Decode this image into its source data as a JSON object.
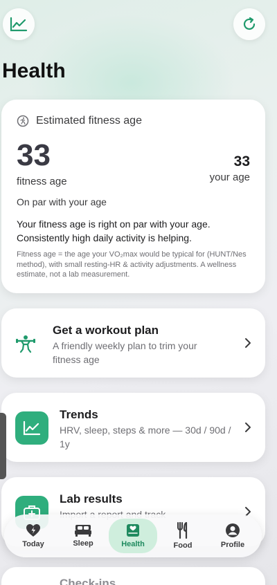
{
  "header": {
    "title": "Health"
  },
  "fitness": {
    "header_label": "Estimated fitness age",
    "fitness_age": "33",
    "fitness_age_label": "fitness age",
    "your_age": "33",
    "your_age_label": "your age",
    "status": "On par with your age",
    "message": "Your fitness age is right on par with your age. Consistently high daily activity is helping.",
    "note": "Fitness age = the age your VO₂max would be typical for (HUNT/Nes method), with small resting-HR & activity adjustments. A wellness estimate, not a lab measurement."
  },
  "workout": {
    "title": "Get a workout plan",
    "subtitle": "A friendly weekly plan to trim your fitness age"
  },
  "trends": {
    "title": "Trends",
    "subtitle": "HRV, sleep, steps & more — 30d / 90d / 1y"
  },
  "lab": {
    "title": "Lab results",
    "subtitle": "Import a report and track"
  },
  "checkins": {
    "title": "Check-ins"
  },
  "tabs": [
    {
      "label": "Today",
      "icon": "heart-bolt-icon"
    },
    {
      "label": "Sleep",
      "icon": "bed-icon"
    },
    {
      "label": "Health",
      "icon": "health-icon",
      "active": true
    },
    {
      "label": "Food",
      "icon": "fork-knife-icon"
    },
    {
      "label": "Profile",
      "icon": "person-icon"
    }
  ],
  "colors": {
    "accent": "#2fae7d",
    "active_tab_bg": "#cfeedd"
  }
}
